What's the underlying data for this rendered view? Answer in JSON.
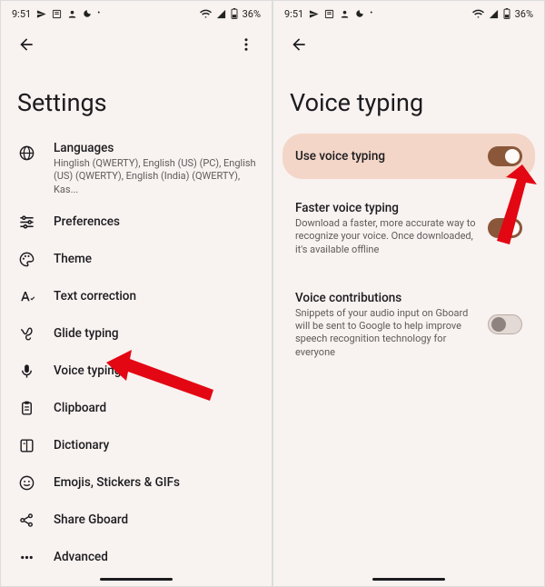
{
  "status": {
    "time": "9:51",
    "battery": "36%"
  },
  "left": {
    "title": "Settings",
    "items": [
      {
        "icon": "globe",
        "title": "Languages",
        "sub": "Hinglish (QWERTY), English (US) (PC), English (US) (QWERTY), English (India) (QWERTY), Kas..."
      },
      {
        "icon": "tune",
        "title": "Preferences"
      },
      {
        "icon": "palette",
        "title": "Theme"
      },
      {
        "icon": "textA",
        "title": "Text correction"
      },
      {
        "icon": "gesture",
        "title": "Glide typing"
      },
      {
        "icon": "mic",
        "title": "Voice typing"
      },
      {
        "icon": "clipboard",
        "title": "Clipboard"
      },
      {
        "icon": "dictionary",
        "title": "Dictionary"
      },
      {
        "icon": "emoji",
        "title": "Emojis, Stickers & GIFs"
      },
      {
        "icon": "share",
        "title": "Share Gboard"
      },
      {
        "icon": "dots",
        "title": "Advanced"
      }
    ]
  },
  "right": {
    "title": "Voice typing",
    "cards": [
      {
        "title": "Use voice typing",
        "sub": "",
        "toggle": "on",
        "highlight": true
      },
      {
        "title": "Faster voice typing",
        "sub": "Download a faster, more accurate way to recognize your voice. Once downloaded, it's available offline",
        "toggle": "on",
        "highlight": false
      },
      {
        "title": "Voice contributions",
        "sub": "Snippets of your audio input on Gboard will be sent to Google to help improve speech recognition technology for everyone",
        "toggle": "off",
        "highlight": false
      }
    ]
  }
}
